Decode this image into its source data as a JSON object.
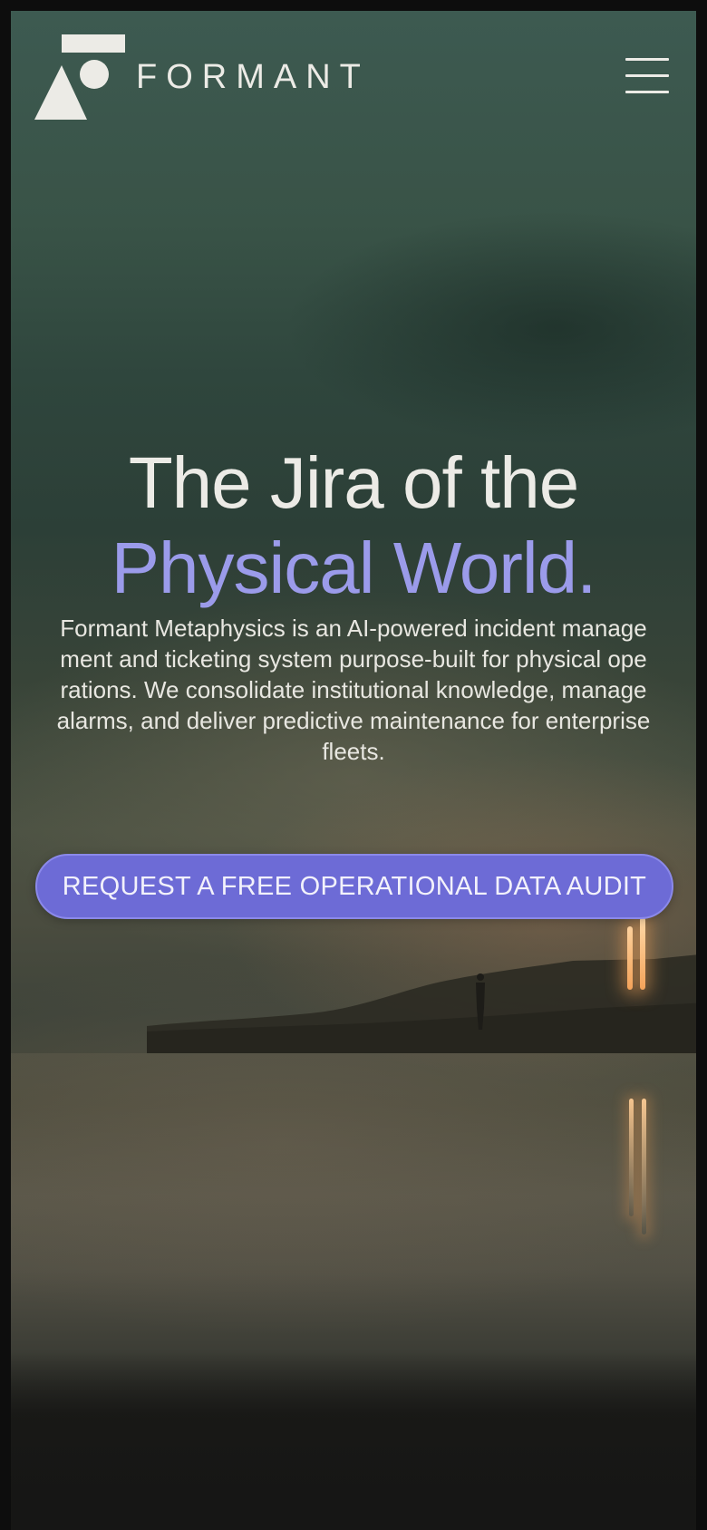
{
  "header": {
    "logo_text": "FORMANT",
    "logo_icon": "formant-logo-mark",
    "menu_icon": "hamburger-menu-icon"
  },
  "hero": {
    "headline_line1": "The Jira of the",
    "headline_line2": "Physical World.",
    "description": "Formant Metaphysics is an AI-powered incident management and ticketing system purpose-built for physical operations. We consolidate institutional knowledge, manage alarms, and deliver predictive maintenance for enterprise fleets.",
    "cta_label": "REQUEST A FREE OPERATIONAL DATA AUDIT"
  },
  "colors": {
    "accent": "#6d6bd6",
    "headline_accent": "#9b9bea",
    "text_light": "#ecebe6"
  }
}
